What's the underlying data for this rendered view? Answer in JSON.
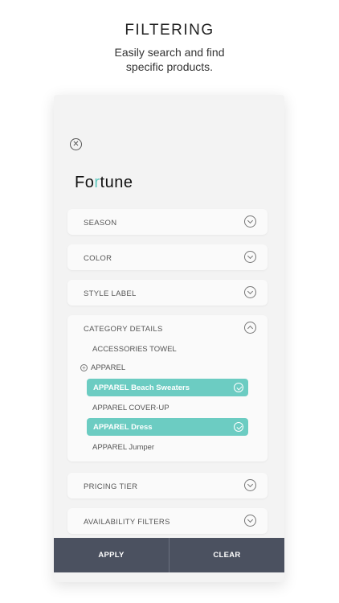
{
  "hero": {
    "title": "FILTERING",
    "subtitle_line1": "Easily search and find",
    "subtitle_line2": "specific products."
  },
  "brand": {
    "name_pre": "Fo",
    "name_dot": "r",
    "name_post": "tune"
  },
  "filters": {
    "season": "SEASON",
    "color": "COLOR",
    "style_label": "STYLE LABEL",
    "category_details": "CATEGORY DETAILS",
    "pricing_tier": "PRICING TIER",
    "availability": "AVAILABILITY FILTERS"
  },
  "category": {
    "accessories_towel": "ACCESSORIES TOWEL",
    "apparel_group": "APPAREL",
    "beach_sweaters": "APPAREL Beach Sweaters",
    "cover_up": "APPAREL COVER-UP",
    "dress": "APPAREL Dress",
    "jumper": "APPAREL Jumper"
  },
  "actions": {
    "apply": "APPLY",
    "clear": "CLEAR"
  },
  "colors": {
    "accent": "#6cccc2",
    "bar": "#4b5160"
  }
}
